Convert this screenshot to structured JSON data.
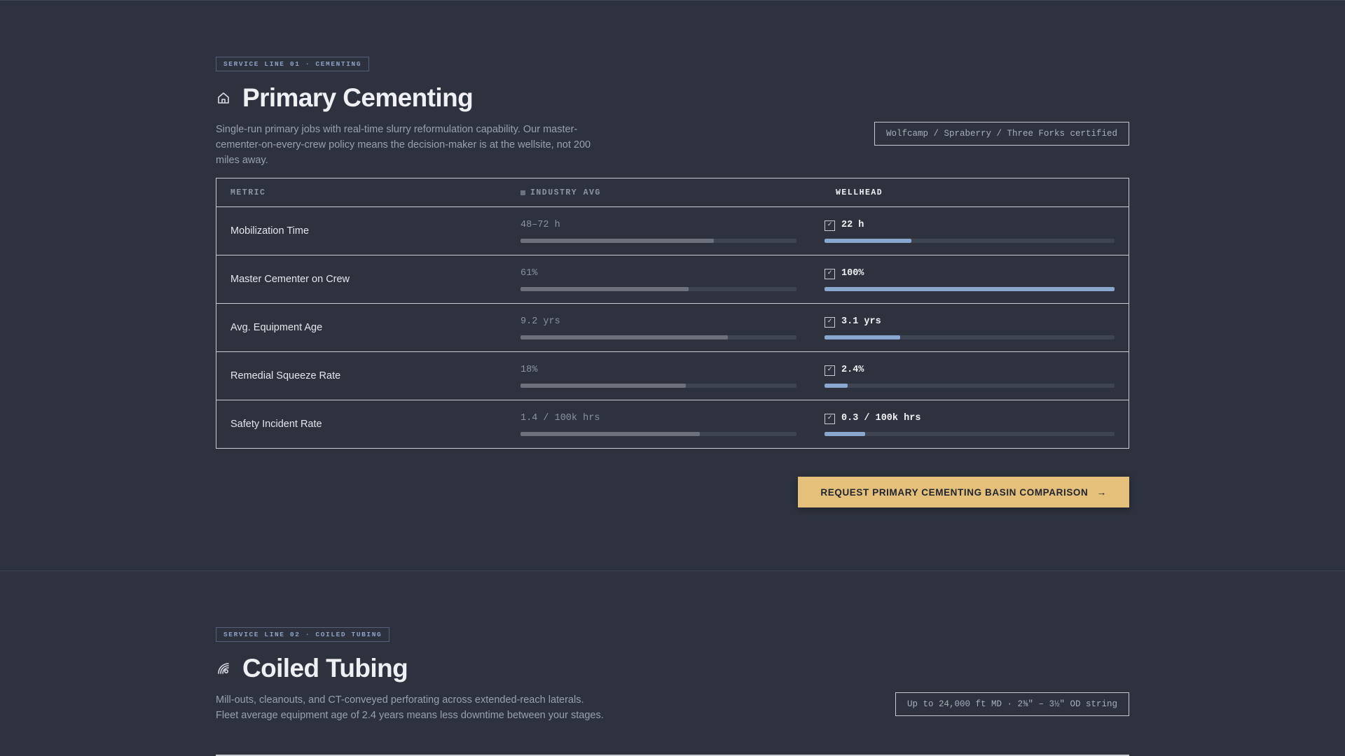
{
  "sections": [
    {
      "eyebrow": "SERVICE LINE 01 · CEMENTING",
      "icon": "home-icon",
      "title": "Primary Cementing",
      "description": "Single-run primary jobs with real-time slurry reformulation capability. Our master-cementer-on-every-crew policy means the decision-maker is at the wellsite, not 200 miles away.",
      "cert": "Wolfcamp / Spraberry / Three Forks certified",
      "table": {
        "headers": {
          "metric": "METRIC",
          "industry": "INDUSTRY AVG",
          "wellhead": "WELLHEAD"
        },
        "rows": [
          {
            "metric": "Mobilization Time",
            "industry": "48–72 h",
            "wellhead": "22 h",
            "industry_fill": 0.7,
            "wellhead_fill": 0.3
          },
          {
            "metric": "Master Cementer on Crew",
            "industry": "61%",
            "wellhead": "100%",
            "industry_fill": 0.61,
            "wellhead_fill": 1.0
          },
          {
            "metric": "Avg. Equipment Age",
            "industry": "9.2 yrs",
            "wellhead": "3.1 yrs",
            "industry_fill": 0.75,
            "wellhead_fill": 0.26
          },
          {
            "metric": "Remedial Squeeze Rate",
            "industry": "18%",
            "wellhead": "2.4%",
            "industry_fill": 0.6,
            "wellhead_fill": 0.08
          },
          {
            "metric": "Safety Incident Rate",
            "industry": "1.4 / 100k hrs",
            "wellhead": "0.3 / 100k hrs",
            "industry_fill": 0.65,
            "wellhead_fill": 0.14
          }
        ]
      },
      "cta": "REQUEST PRIMARY CEMENTING BASIN COMPARISON"
    },
    {
      "eyebrow": "SERVICE LINE 02 · COILED TUBING",
      "icon": "coil-icon",
      "title": "Coiled Tubing",
      "description": "Mill-outs, cleanouts, and CT-conveyed perforating across extended-reach laterals. Fleet average equipment age of 2.4 years means less downtime between your stages.",
      "cert": "Up to 24,000 ft MD · 2⅜\" – 3½\" OD string"
    }
  ],
  "colors": {
    "background": "#2d323e",
    "accent": "#e5c07b",
    "wellhead_bar": "#8aa7cf",
    "industry_bar": "#6c717b"
  }
}
